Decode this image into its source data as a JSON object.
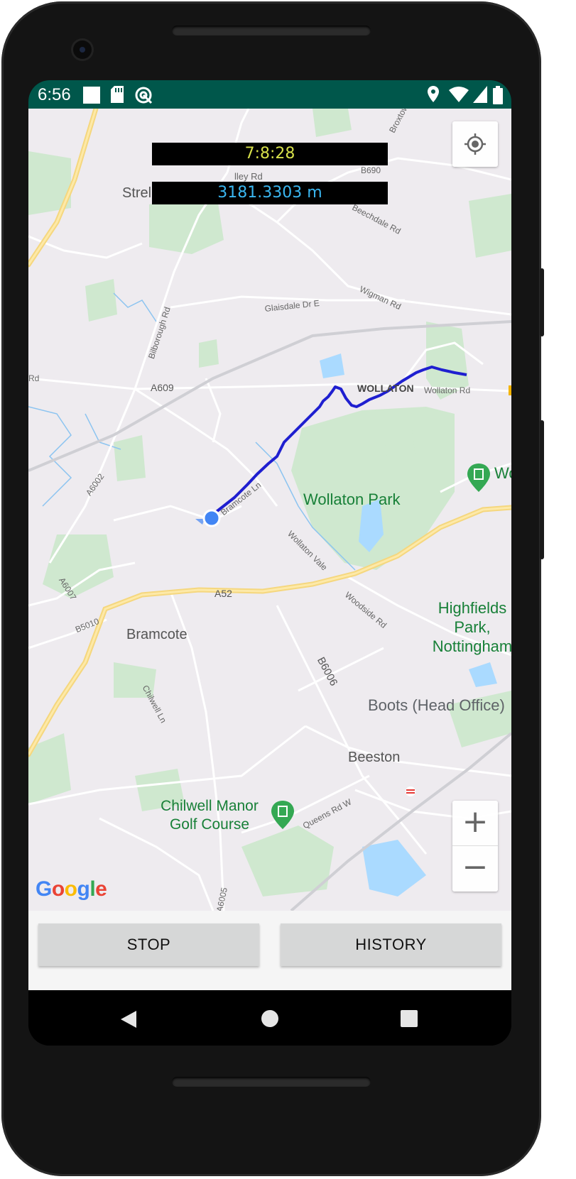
{
  "status_bar": {
    "time": "6:56",
    "icons_left": [
      "stop-square-icon",
      "sd-card-icon",
      "sync-icon"
    ],
    "icons_right": [
      "location-pin-icon",
      "wifi-icon",
      "cellular-icon",
      "battery-icon"
    ],
    "color": "#00574B"
  },
  "overlay": {
    "timer": "7:8:28",
    "distance": "3181.3303 m",
    "timer_color": "#d7e04a",
    "distance_color": "#3ab6f0"
  },
  "map": {
    "controls": {
      "my_location_icon": "crosshair-location-icon",
      "zoom_in_label": "+",
      "zoom_out_label": "−"
    },
    "logo": "Google",
    "route_color": "#1f1fd0",
    "labels": {
      "streets_partial": "Strel",
      "valley_rd": "lley Rd",
      "broxtowe": "Broxtowe",
      "b690": "B690",
      "beechdale_rd": "Beechdale Rd",
      "wigman_rd": "Wigman Rd",
      "glaisdale": "Glaisdale Dr E",
      "bilborough_rd": "Bilborough Rd",
      "rd_left": "Rd",
      "a609": "A609",
      "wollaton": "WOLLATON",
      "wollaton_rd": "Wollaton Rd",
      "a6002": "A6002",
      "bramcote_ln": "Bramcote Ln",
      "wollaton_park": "Wollaton Park",
      "wollaton_vale": "Wollaton Vale",
      "wo_partial": "Wo",
      "a6007": "A6007",
      "a52": "A52",
      "woodside_rd": "Woodside Rd",
      "b5010": "B5010",
      "bramcote": "Bramcote",
      "highfields_line1": "Highfields",
      "highfields_line2": "Park,",
      "highfields_line3": "Nottingham",
      "b6006": "B6006",
      "chilwell_ln": "Chilwell Ln",
      "boots": "Boots (Head Office)",
      "beeston": "Beeston",
      "chilwell_manor_line1": "Chilwell Manor",
      "chilwell_manor_line2": "Golf Course",
      "queens_rd": "Queens Rd W",
      "a6005": "A6005"
    }
  },
  "buttons": {
    "stop": "STOP",
    "history": "HISTORY"
  },
  "nav_bar": {
    "back_icon": "back-triangle-icon",
    "home_icon": "home-circle-icon",
    "recents_icon": "recents-square-icon"
  }
}
